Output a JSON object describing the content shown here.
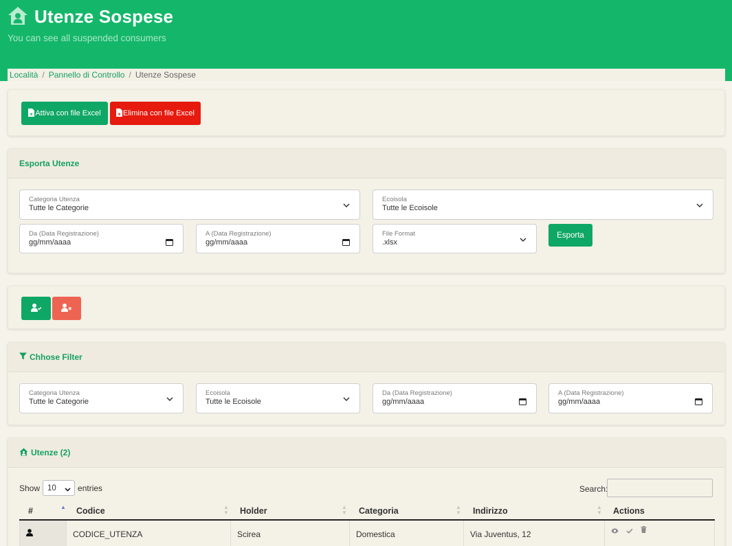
{
  "header": {
    "title": "Utenze Sospese",
    "subtitle": "You can see all suspended consumers"
  },
  "breadcrumb": {
    "items": [
      "Località",
      "Pannello di Controllo"
    ],
    "current": "Utenze Sospese"
  },
  "import_actions": {
    "activate_label": "Attiva con file Excel",
    "delete_label": "Elimina con file Excel"
  },
  "export": {
    "title": "Esporta Utenze",
    "category": {
      "label": "Categoria Utenza",
      "value": "Tutte le Categorie"
    },
    "ecoisola": {
      "label": "Ecoisola",
      "value": "Tutte le Ecoisole"
    },
    "date_from": {
      "label": "Da (Data Registrazione)",
      "value": "gg/mm/aaaa"
    },
    "date_to": {
      "label": "A (Data Registrazione)",
      "value": "gg/mm/aaaa"
    },
    "file_format": {
      "label": "File Format",
      "value": ".xlsx"
    },
    "export_button": "Esporta"
  },
  "filter": {
    "title": "Chhose Filter",
    "category": {
      "label": "Categoria Utenza",
      "value": "Tutte le Categorie"
    },
    "ecoisola": {
      "label": "Ecoisola",
      "value": "Tutte le Ecoisole"
    },
    "date_from": {
      "label": "Da (Data Registrazione)",
      "value": "gg/mm/aaaa"
    },
    "date_to": {
      "label": "A (Data Registrazione)",
      "value": "gg/mm/aaaa"
    }
  },
  "utenze": {
    "title": "Utenze (2)",
    "show_label": "Show",
    "entries_value": "10",
    "entries_label": "entries",
    "search_label": "Search:",
    "columns": [
      "#",
      "Codice",
      "Holder",
      "Categoria",
      "Indirizzo",
      "Actions"
    ],
    "rows": [
      {
        "codice": "CODICE_UTENZA",
        "holder": "Scirea",
        "categoria": "Domestica",
        "indirizzo": "Via Juventus, 12"
      }
    ]
  },
  "colors": {
    "brand_green": "#14b76a",
    "button_green": "#0fa765",
    "button_red": "#e61a0e",
    "button_salmon": "#ee6452",
    "page_bg": "#f6f3ea"
  }
}
